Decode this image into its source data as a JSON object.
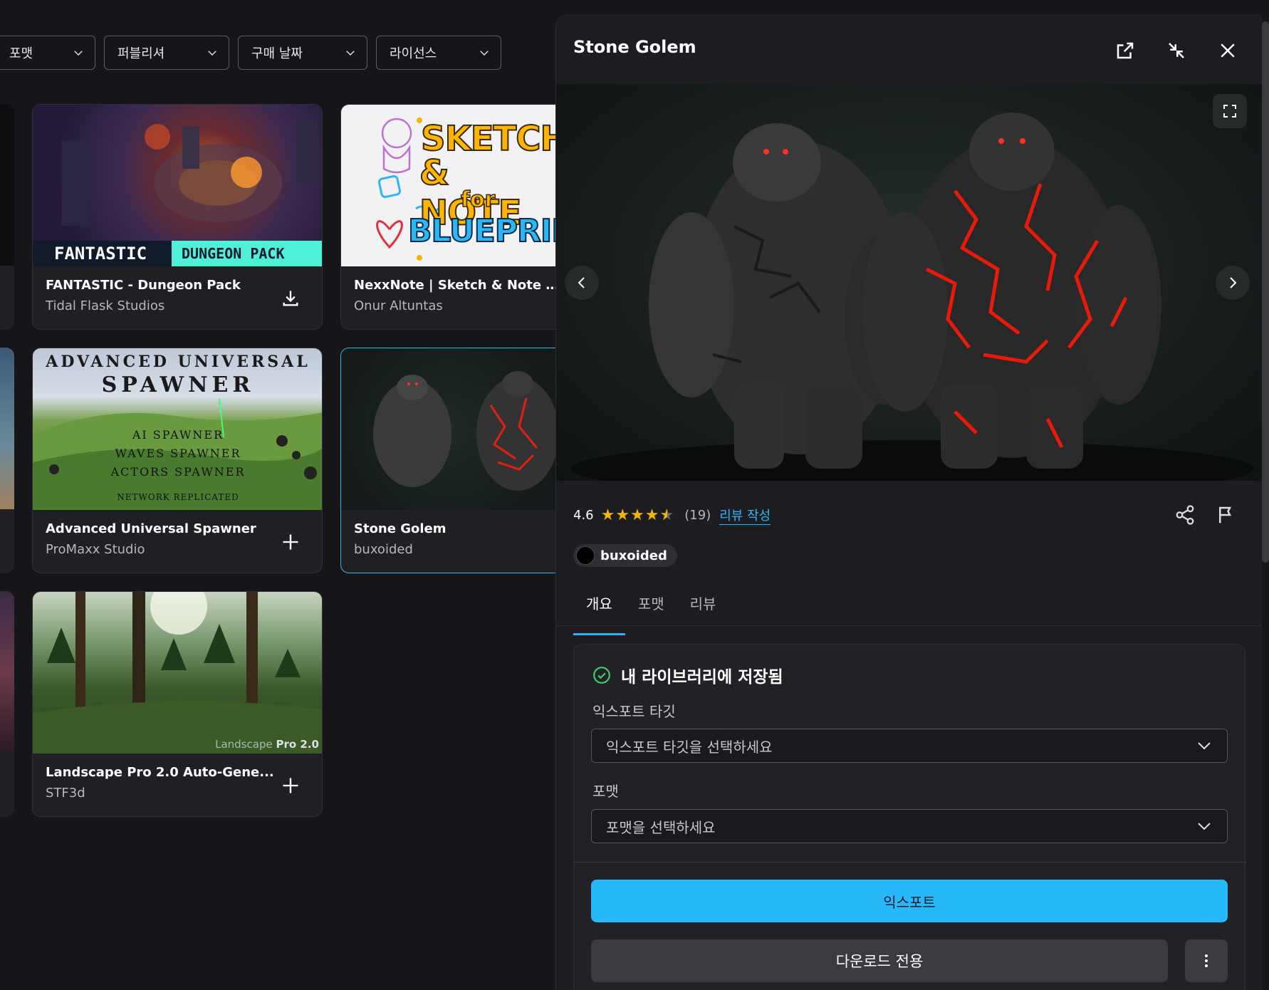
{
  "filters": [
    {
      "label": "포맷"
    },
    {
      "label": "퍼블리셔"
    },
    {
      "label": "구매 날짜"
    },
    {
      "label": "라이선스"
    }
  ],
  "cards": [
    {
      "title": "FANTASTIC - Dungeon Pack",
      "publisher": "Tidal Flask Studios",
      "action": "download-icon",
      "thumb_text_1": "FANTASTIC",
      "thumb_text_2": "DUNGEON PACK"
    },
    {
      "title": "NexxNote | Sketch & Note for ...",
      "publisher": "Onur Altuntas",
      "thumb_text_1": "SKETCH",
      "thumb_text_2": "& NOTE",
      "thumb_text_3": "for",
      "thumb_text_4": "BLUEPRINT"
    },
    {
      "title": "Advanced Universal Spawner",
      "publisher": "ProMaxx Studio",
      "action": "plus-icon",
      "thumb_text_1": "ADVANCED UNIVERSAL",
      "thumb_text_2": "SPAWNER",
      "thumb_text_3": "AI SPAWNER",
      "thumb_text_4": "WAVES SPAWNER",
      "thumb_text_5": "ACTORS SPAWNER",
      "thumb_text_6": "NETWORK REPLICATED"
    },
    {
      "title": "Stone Golem",
      "publisher": "buxoided"
    },
    {
      "title": "Landscape Pro 2.0 Auto-Gene...",
      "publisher": "STF3d",
      "action": "plus-icon",
      "thumb_text_1": "Landscape",
      "thumb_text_2": "Pro 2.0"
    }
  ],
  "panel": {
    "title": "Stone Golem",
    "rating": "4.6",
    "stars": "★★★★",
    "star_half": "★",
    "review_count": "(19)",
    "review_link": "리뷰 작성",
    "publisher": "buxoided",
    "tabs": [
      {
        "label": "개요",
        "active": true
      },
      {
        "label": "포맷",
        "active": false
      },
      {
        "label": "리뷰",
        "active": false
      }
    ],
    "saved_label": "내 라이브러리에 저장됨",
    "export_target_label": "익스포트 타깃",
    "export_target_placeholder": "익스포트 타깃을 선택하세요",
    "format_label": "포맷",
    "format_placeholder": "포맷을 선택하세요",
    "export_button": "익스포트",
    "download_button": "다운로드 전용"
  },
  "colors": {
    "accent": "#26b8f8",
    "star": "#f5b400",
    "success": "#3ecf6e",
    "background": "#16161a"
  }
}
